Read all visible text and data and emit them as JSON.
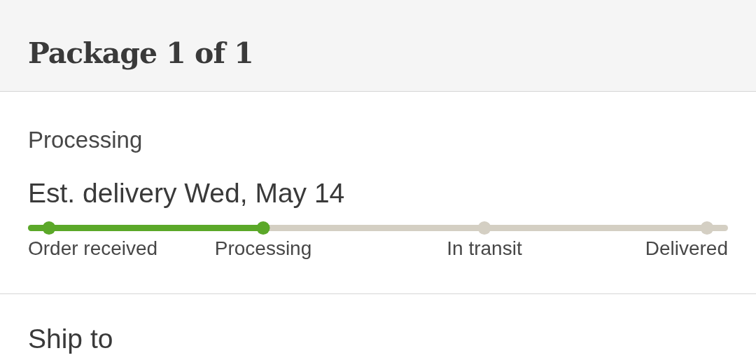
{
  "header": {
    "title": "Package 1 of 1"
  },
  "status": {
    "label": "Processing",
    "estimate": "Est. delivery Wed, May 14"
  },
  "tracker": {
    "level": 0.336,
    "steps": [
      {
        "label": "Order received",
        "done": true
      },
      {
        "label": "Processing",
        "done": true
      },
      {
        "label": "In transit",
        "done": false
      },
      {
        "label": "Delivered",
        "done": false
      }
    ]
  },
  "ship_to": {
    "heading": "Ship to"
  }
}
